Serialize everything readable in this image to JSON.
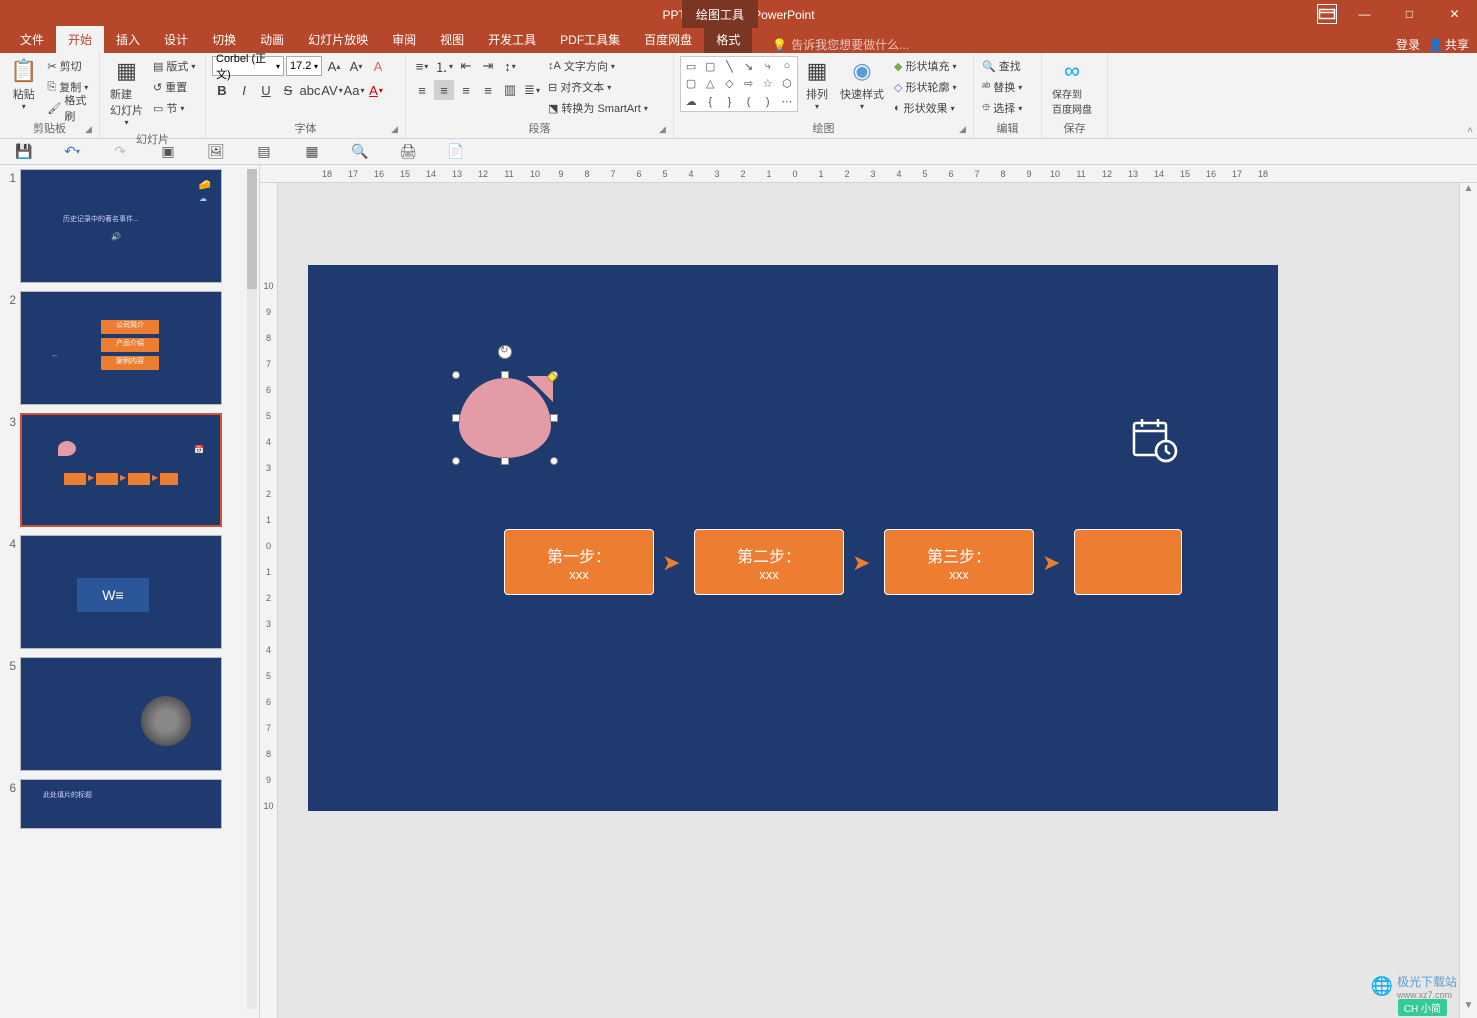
{
  "window": {
    "title": "PPT教程2.pptx - PowerPoint",
    "tools_tab": "绘图工具"
  },
  "win_controls": {
    "minimize": "—",
    "maximize": "□",
    "close": "✕"
  },
  "tabs": {
    "file": "文件",
    "home": "开始",
    "insert": "插入",
    "design": "设计",
    "transitions": "切换",
    "animations": "动画",
    "slideshow": "幻灯片放映",
    "review": "审阅",
    "view": "视图",
    "developer": "开发工具",
    "pdf": "PDF工具集",
    "baidu": "百度网盘",
    "format": "格式",
    "tell_me": "告诉我您想要做什么...",
    "login": "登录",
    "share": "共享"
  },
  "ribbon": {
    "clipboard": {
      "label": "剪贴板",
      "paste": "粘贴",
      "cut": "剪切",
      "copy": "复制",
      "format_painter": "格式刷"
    },
    "slides": {
      "label": "幻灯片",
      "new_slide": "新建\n幻灯片",
      "layout": "版式",
      "reset": "重置",
      "section": "节"
    },
    "font": {
      "label": "字体",
      "name": "Corbel (正文)",
      "size": "17.2"
    },
    "paragraph": {
      "label": "段落",
      "text_direction": "文字方向",
      "align_text": "对齐文本",
      "smartart": "转换为 SmartArt"
    },
    "drawing": {
      "label": "绘图",
      "arrange": "排列",
      "quick_styles": "快速样式",
      "shape_fill": "形状填充",
      "shape_outline": "形状轮廓",
      "shape_effects": "形状效果"
    },
    "editing": {
      "label": "编辑",
      "find": "查找",
      "replace": "替换",
      "select": "选择"
    },
    "save": {
      "label": "保存",
      "save_to": "保存到\n百度网盘"
    }
  },
  "slide": {
    "step1_title": "第一步：",
    "step1_sub": "xxx",
    "step2_title": "第二步：",
    "step2_sub": "xxx",
    "step3_title": "第三步：",
    "step3_sub": "xxx"
  },
  "thumbs": {
    "t1": "历史记录中的著名事件...",
    "t2a": "公司简介",
    "t2b": "产品介绍",
    "t2c": "案例内容",
    "t6": "此处填片的标题"
  },
  "ruler_h": [
    "18",
    "17",
    "16",
    "15",
    "14",
    "13",
    "12",
    "11",
    "10",
    "9",
    "8",
    "7",
    "6",
    "5",
    "4",
    "3",
    "2",
    "1",
    "0",
    "1",
    "2",
    "3",
    "4",
    "5",
    "6",
    "7",
    "8",
    "9",
    "10",
    "11",
    "12",
    "13",
    "14",
    "15",
    "16",
    "17",
    "18"
  ],
  "ruler_v": [
    "10",
    "9",
    "8",
    "7",
    "6",
    "5",
    "4",
    "3",
    "2",
    "1",
    "0",
    "1",
    "2",
    "3",
    "4",
    "5",
    "6",
    "7",
    "8",
    "9",
    "10"
  ],
  "watermark": "极光下载站",
  "watermark_url": "www.xz7.com",
  "lang": "CH 小简"
}
